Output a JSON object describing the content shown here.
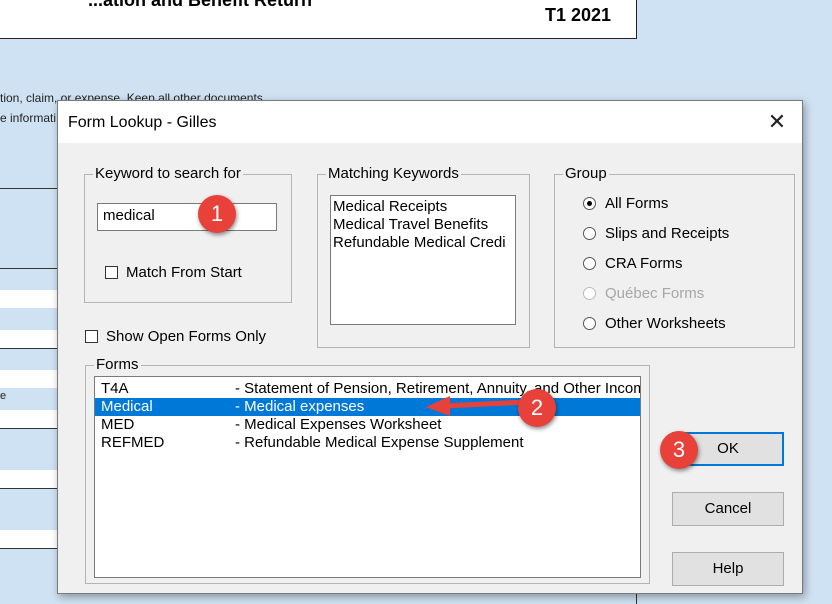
{
  "background": {
    "title_fragment": "...ation and Benefit Return",
    "form_code": "T1 2021",
    "text_line1": "tion, claim, or expense. Keep all other documents",
    "text_line2": "e informati",
    "side_fragment": "e"
  },
  "dialog": {
    "title": "Form Lookup - Gilles",
    "keyword_group": {
      "legend": "Keyword to search for",
      "input_value": "medical",
      "match_from_start_label": "Match From Start",
      "match_from_start_checked": false
    },
    "matching_group": {
      "legend": "Matching Keywords",
      "items": [
        "Medical Receipts",
        "Medical Travel Benefits",
        "Refundable Medical Credi"
      ]
    },
    "group_box": {
      "legend": "Group",
      "options": [
        {
          "label": "All Forms",
          "checked": true,
          "disabled": false
        },
        {
          "label": "Slips and Receipts",
          "checked": false,
          "disabled": false
        },
        {
          "label": "CRA Forms",
          "checked": false,
          "disabled": false
        },
        {
          "label": "Québec Forms",
          "checked": false,
          "disabled": true
        },
        {
          "label": "Other Worksheets",
          "checked": false,
          "disabled": false
        }
      ]
    },
    "show_open_forms_label": "Show Open Forms Only",
    "forms_group": {
      "legend": "Forms",
      "rows": [
        {
          "code": "T4A",
          "description": "- Statement of Pension, Retirement, Annuity, and Other Income",
          "selected": false
        },
        {
          "code": "Medical",
          "description": "- Medical expenses",
          "selected": true
        },
        {
          "code": "MED",
          "description": "- Medical Expenses Worksheet",
          "selected": false
        },
        {
          "code": "REFMED",
          "description": "- Refundable Medical Expense Supplement",
          "selected": false
        }
      ]
    },
    "buttons": {
      "ok": "OK",
      "cancel": "Cancel",
      "help": "Help"
    }
  },
  "annotations": {
    "badge1": "1",
    "badge2": "2",
    "badge3": "3",
    "badge_color": "#e8413a",
    "selection_color": "#0078d7"
  }
}
